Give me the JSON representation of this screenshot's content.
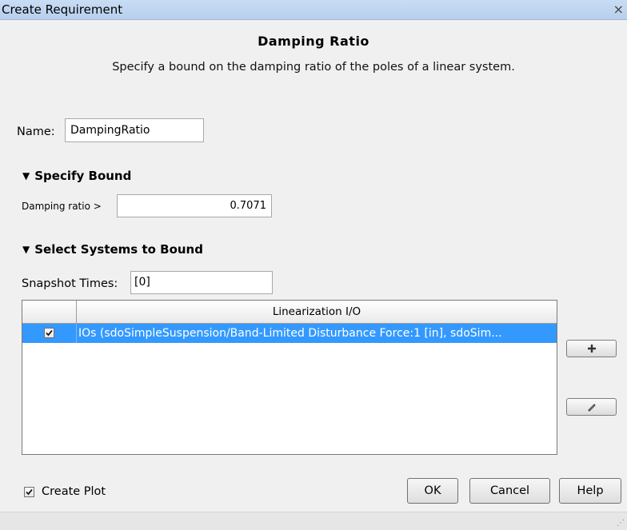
{
  "window": {
    "title": "Create Requirement",
    "close_glyph": "×"
  },
  "header": {
    "heading": "Damping Ratio",
    "description": "Specify a bound on the damping ratio of the poles of a linear system."
  },
  "name_field": {
    "label": "Name:",
    "value": "DampingRatio"
  },
  "specify_bound": {
    "title": "Specify Bound",
    "expanded": true,
    "damping_label": "Damping ratio >",
    "damping_value": "0.7071"
  },
  "select_systems": {
    "title": "Select Systems to Bound",
    "expanded": true,
    "snapshot_label": "Snapshot Times:",
    "snapshot_value": "[0]",
    "table": {
      "columns": [
        "",
        "Linearization I/O"
      ],
      "rows": [
        {
          "checked": true,
          "selected": true,
          "text": "IOs (sdoSimpleSuspension/Band-Limited Disturbance Force:1 [in], sdoSim..."
        }
      ]
    },
    "add_button_icon": "plus-icon",
    "edit_button_icon": "pencil-icon"
  },
  "footer": {
    "create_plot_label": "Create Plot",
    "create_plot_checked": true,
    "ok_label": "OK",
    "cancel_label": "Cancel",
    "help_label": "Help"
  },
  "colors": {
    "selection": "#3399ff",
    "titlebar": "#c8dcf3",
    "dialog_background": "#f0f0f0"
  }
}
